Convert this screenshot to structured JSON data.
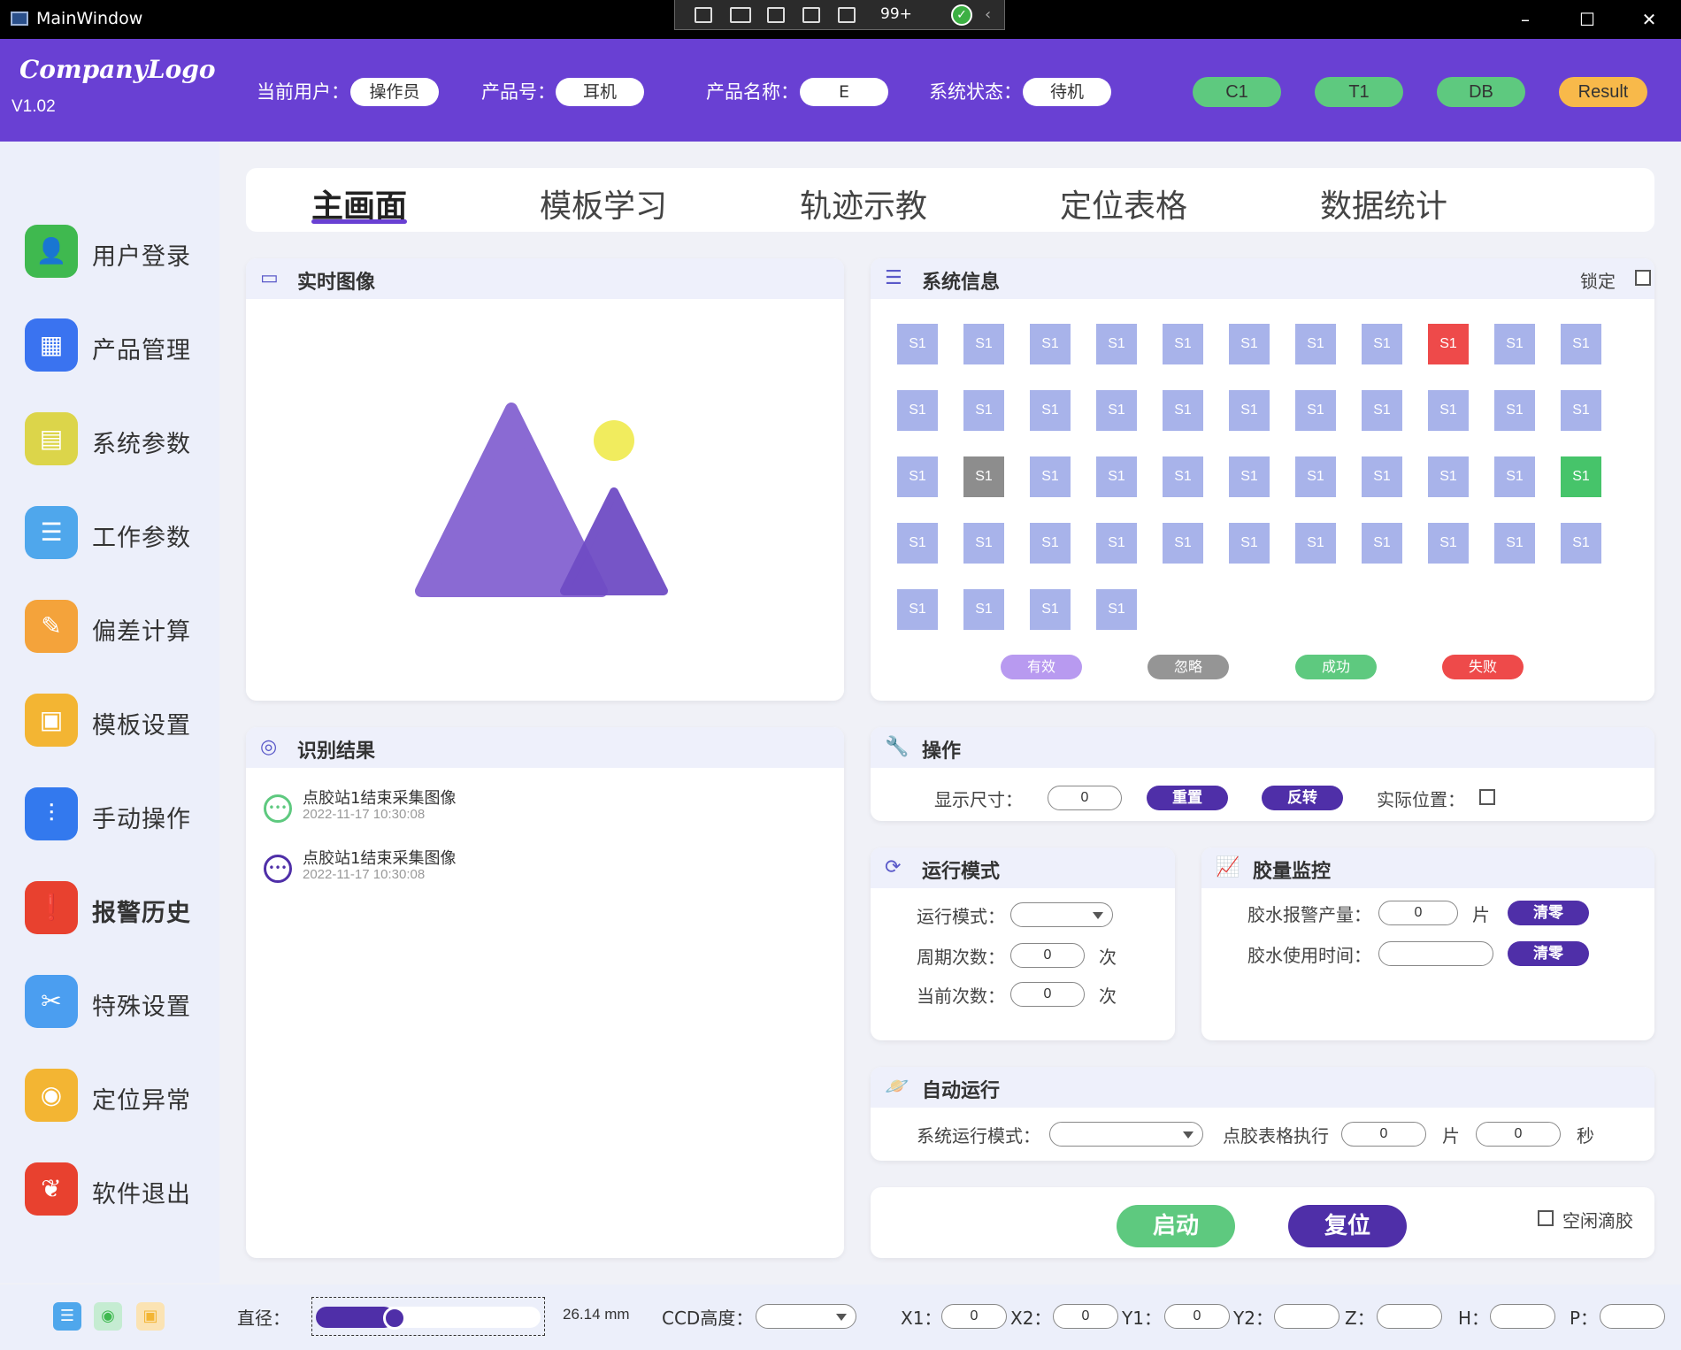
{
  "window": {
    "title": "MainWindow",
    "debug_count": "99+"
  },
  "header": {
    "logo": "CompanyLogo",
    "version": "V1.02",
    "current_user_label": "当前用户：",
    "current_user": "操作员",
    "product_no_label": "产品号：",
    "product_no": "耳机",
    "product_name_label": "产品名称：",
    "product_name": "E",
    "system_status_label": "系统状态：",
    "system_status": "待机",
    "buttons": [
      "C1",
      "T1",
      "DB",
      "Result"
    ]
  },
  "sidebar": {
    "items": [
      {
        "label": "用户登录",
        "icon": "user-icon",
        "color": "#3fb94f"
      },
      {
        "label": "产品管理",
        "icon": "grid-icon",
        "color": "#3a73f0"
      },
      {
        "label": "系统参数",
        "icon": "settings-doc-icon",
        "color": "#dcd54a"
      },
      {
        "label": "工作参数",
        "icon": "clipboard-icon",
        "color": "#4fa7ec"
      },
      {
        "label": "偏差计算",
        "icon": "edit-icon",
        "color": "#f4a33b"
      },
      {
        "label": "模板设置",
        "icon": "template-icon",
        "color": "#f3b533"
      },
      {
        "label": "手动操作",
        "icon": "sliders-icon",
        "color": "#3379ee"
      },
      {
        "label": "报警历史",
        "icon": "alarm-doc-icon",
        "color": "#e8412f"
      },
      {
        "label": "特殊设置",
        "icon": "tools-icon",
        "color": "#4b9ef0"
      },
      {
        "label": "定位异常",
        "icon": "location-icon",
        "color": "#f3b533"
      },
      {
        "label": "软件退出",
        "icon": "leaf-icon",
        "color": "#e8412f"
      }
    ]
  },
  "tabs": [
    "主画面",
    "模板学习",
    "轨迹示教",
    "定位表格",
    "数据统计"
  ],
  "live_image": {
    "title": "实时图像"
  },
  "system_info": {
    "title": "系统信息",
    "lock_label": "锁定",
    "cell_label": "S1",
    "cell_colors": {
      "default": "#a8b3ea",
      "failed": "#ee4a4a",
      "ignored": "#8d8d8d",
      "success": "#46c46a"
    },
    "legend": [
      {
        "label": "有效",
        "color": "#b89af0"
      },
      {
        "label": "忽略",
        "color": "#959595"
      },
      {
        "label": "成功",
        "color": "#5ec97f"
      },
      {
        "label": "失败",
        "color": "#ee4a4a"
      }
    ]
  },
  "results": {
    "title": "识别结果",
    "items": [
      {
        "text": "点胶站1结束采集图像",
        "time": "2022-11-17 10:30:08",
        "color": "#5ec97f"
      },
      {
        "text": "点胶站1结束采集图像",
        "time": "2022-11-17 10:30:08",
        "color": "#4f2fa8"
      }
    ]
  },
  "operation": {
    "title": "操作",
    "display_size_label": "显示尺寸：",
    "display_size": "0",
    "reset_label": "重置",
    "flip_label": "反转",
    "actual_pos_label": "实际位置："
  },
  "run_mode": {
    "title": "运行模式",
    "mode_label": "运行模式：",
    "mode_value": "",
    "cycles_label": "周期次数：",
    "cycles": "0",
    "cycles_unit": "次",
    "current_label": "当前次数：",
    "current": "0",
    "current_unit": "次"
  },
  "glue_monitor": {
    "title": "胶量监控",
    "alarm_output_label": "胶水报警产量：",
    "alarm_output": "0",
    "alarm_unit": "片",
    "clear1": "清零",
    "use_time_label": "胶水使用时间：",
    "use_time": "",
    "clear2": "清零"
  },
  "auto_run": {
    "title": "自动运行",
    "sys_mode_label": "系统运行模式：",
    "sys_mode": "",
    "exec_label": "点胶表格执行",
    "exec_value": "0",
    "exec_unit": "片",
    "seconds_value": "0",
    "seconds_unit": "秒"
  },
  "controls": {
    "start": "启动",
    "reset": "复位",
    "idle_drip_label": "空闲滴胶"
  },
  "footer": {
    "diameter_label": "直径：",
    "diameter_value": "26.14 mm",
    "diameter_fraction": 0.3,
    "ccd_label": "CCD高度：",
    "ccd_value": "",
    "x1_label": "X1：",
    "x1": "0",
    "x2_label": "X2：",
    "x2": "0",
    "y1_label": "Y1：",
    "y1": "0",
    "y2_label": "Y2：",
    "y2": "",
    "z_label": "Z：",
    "z": "",
    "h_label": "H：",
    "h": "",
    "p_label": "P：",
    "p": ""
  }
}
